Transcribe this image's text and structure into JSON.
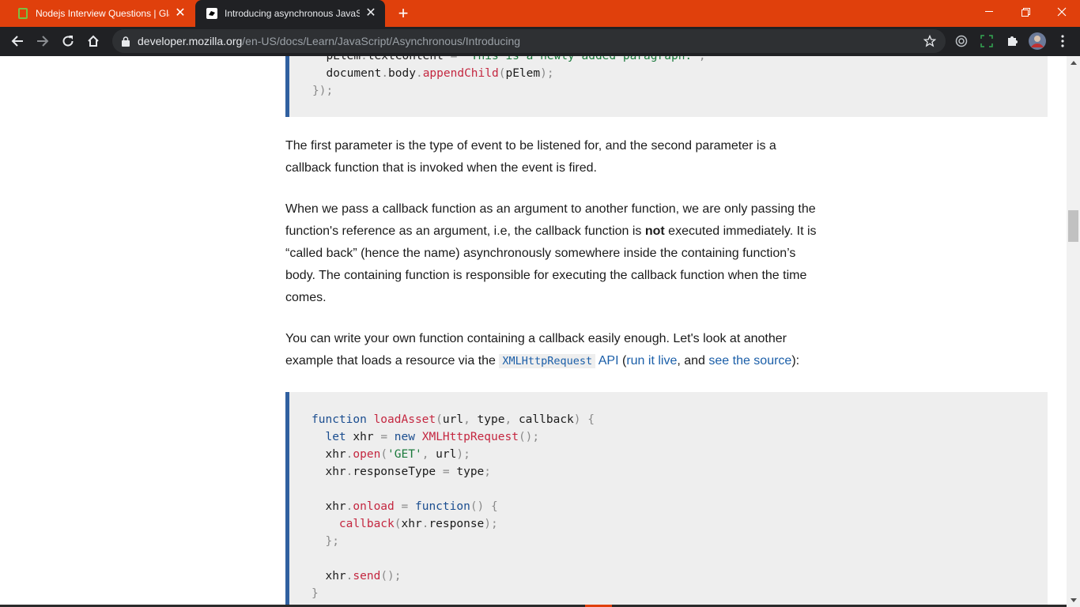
{
  "browser": {
    "tabs": [
      {
        "title": "Nodejs Interview Questions | Gla",
        "favicon": "glassdoor-icon",
        "active": false
      },
      {
        "title": "Introducing asynchronous JavaSc",
        "favicon": "mdn-icon",
        "active": true
      }
    ],
    "url_host": "developer.mozilla.org",
    "url_path": "/en-US/docs/Learn/JavaScript/Asynchronous/Introducing",
    "colors": {
      "tabstrip": "#e0400c",
      "toolbar": "#202124"
    }
  },
  "content": {
    "code_block_1": [
      "  pElem.textContent = 'This is a newly added paragraph.';",
      "  document.body.appendChild(pElem);",
      "});"
    ],
    "paragraph_1": "The first parameter is the type of event to be listened for, and the second parameter is a callback function that is invoked when the event is fired.",
    "paragraph_2": {
      "before": "When we pass a callback function as an argument to another function, we are only passing the function's reference as an argument, i.e, the callback function is ",
      "bold": "not",
      "after": " executed immediately. It is “called back” (hence the name) asynchronously somewhere inside the containing function’s body. The containing function is responsible for executing the callback function when the time comes."
    },
    "paragraph_3": {
      "before": "You can write your own function containing a callback easily enough. Let's look at another example that loads a resource via the ",
      "code_link": "XMLHttpRequest",
      "link_api": "API",
      "mid1": " (",
      "link_run": "run it live",
      "mid2": ", and ",
      "link_source": "see the source",
      "end": "):"
    },
    "code_block_2": [
      "function loadAsset(url, type, callback) {",
      "  let xhr = new XMLHttpRequest();",
      "  xhr.open('GET', url);",
      "  xhr.responseType = type;",
      "",
      "  xhr.onload = function() {",
      "    callback(xhr.response);",
      "  };",
      "",
      "  xhr.send();",
      "}"
    ]
  }
}
